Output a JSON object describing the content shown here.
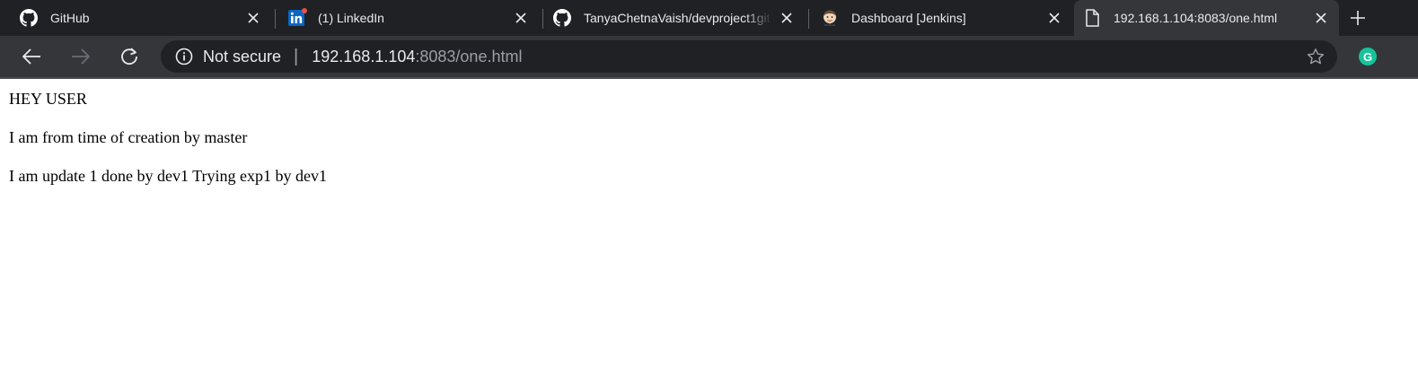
{
  "tabs": [
    {
      "title": "GitHub",
      "icon": "github-icon",
      "active": false
    },
    {
      "title": "(1) LinkedIn",
      "icon": "linkedin-icon",
      "active": false
    },
    {
      "title": "TanyaChetnaVaish/devproject1git",
      "icon": "github-icon",
      "active": false
    },
    {
      "title": "Dashboard [Jenkins]",
      "icon": "jenkins-icon",
      "active": false
    },
    {
      "title": "192.168.1.104:8083/one.html",
      "icon": "page-icon",
      "active": true
    }
  ],
  "omnibox": {
    "security_label": "Not secure",
    "separator": "|",
    "url_host": "192.168.1.104",
    "url_rest": ":8083/one.html"
  },
  "extension": {
    "grammarly_letter": "G",
    "grammarly_color": "#15c39a"
  },
  "page": {
    "lines": [
      "HEY USER",
      "I am from time of creation by master",
      "I am update 1 done by dev1 Trying exp1 by dev1"
    ]
  },
  "colors": {
    "tabstrip_bg": "#202124",
    "toolbar_bg": "#35363a",
    "omnibox_bg": "#202124",
    "text_light": "#e8eaed",
    "text_dim": "#9aa0a6"
  }
}
